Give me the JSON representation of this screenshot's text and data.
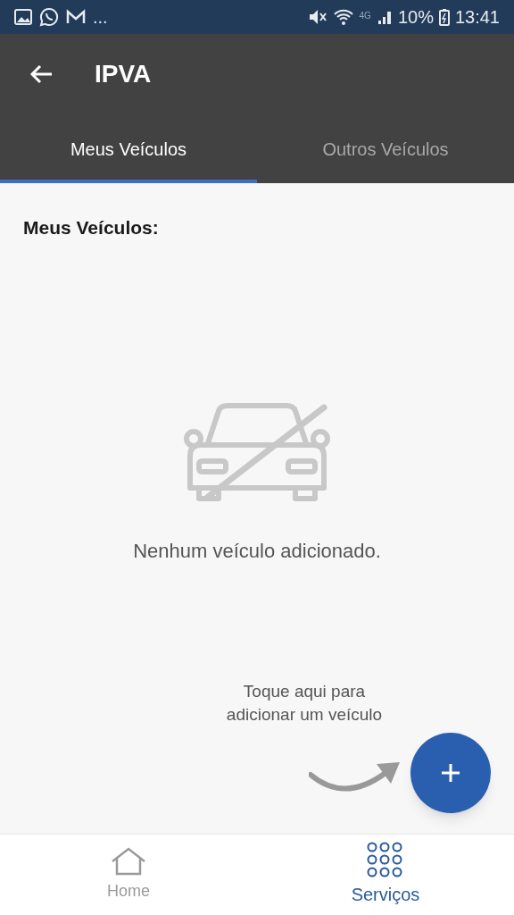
{
  "status_bar": {
    "overflow": "...",
    "network": "4G",
    "battery": "10%",
    "time": "13:41"
  },
  "app_bar": {
    "title": "IPVA"
  },
  "tabs": [
    {
      "label": "Meus Veículos",
      "selected": true
    },
    {
      "label": "Outros Veículos",
      "selected": false
    }
  ],
  "section_title": "Meus Veículos:",
  "empty_state": {
    "message": "Nenhum veículo adicionado."
  },
  "hint": "Toque aqui para adicionar um veículo",
  "bottom_nav": [
    {
      "kind": "home",
      "label": "Home",
      "selected": false
    },
    {
      "kind": "grid",
      "label": "Serviços",
      "selected": true
    }
  ]
}
